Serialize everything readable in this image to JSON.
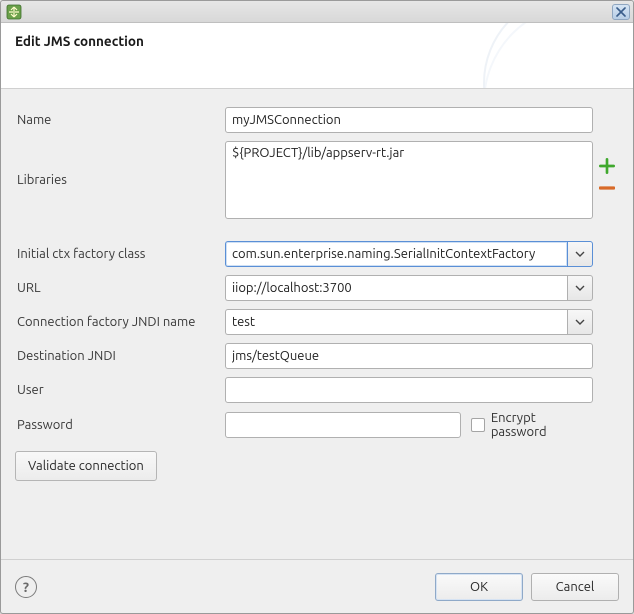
{
  "titlebar": {
    "title": ""
  },
  "header": {
    "title": "Edit JMS connection"
  },
  "labels": {
    "name": "Name",
    "libraries": "Libraries",
    "ctx_factory": "Initial ctx factory class",
    "url": "URL",
    "conn_factory_jndi": "Connection factory JNDI name",
    "destination_jndi": "Destination JNDI",
    "user": "User",
    "password": "Password",
    "encrypt_password": "Encrypt password",
    "validate": "Validate connection"
  },
  "values": {
    "name": "myJMSConnection",
    "libraries": "${PROJECT}/lib/appserv-rt.jar",
    "ctx_factory": "com.sun.enterprise.naming.SerialInitContextFactory",
    "url": "iiop://localhost:3700",
    "conn_factory_jndi": "test",
    "destination_jndi": "jms/testQueue",
    "user": "",
    "password": "",
    "encrypt_password": false
  },
  "footer": {
    "ok": "OK",
    "cancel": "Cancel"
  },
  "icons": {
    "add": "plus-icon",
    "remove": "minus-icon"
  }
}
